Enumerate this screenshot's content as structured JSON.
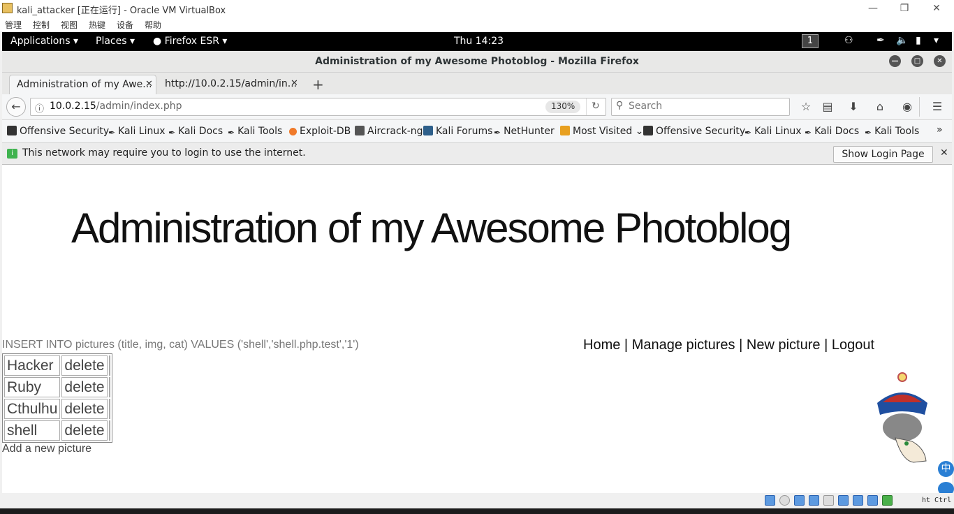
{
  "vbox": {
    "title": "kali_attacker [正在运行] - Oracle VM VirtualBox",
    "menu": [
      "管理",
      "控制",
      "视图",
      "热键",
      "设备",
      "帮助"
    ],
    "status_text": "ht Ctrl"
  },
  "gnome": {
    "applications": "Applications",
    "places": "Places",
    "firefox": "Firefox ESR",
    "clock": "Thu 14:23",
    "workspace": "1"
  },
  "firefox": {
    "window_title": "Administration of my Awesome Photoblog - Mozilla Firefox",
    "tabs": [
      {
        "label": "Administration of my Awe...",
        "active": true
      },
      {
        "label": "http://10.0.2.15/admin/in...",
        "active": false
      }
    ],
    "url_host": "10.0.2.15",
    "url_path": "/admin/index.php",
    "zoom": "130%",
    "search_placeholder": "Search",
    "bookmarks": [
      "Offensive Security",
      "Kali Linux",
      "Kali Docs",
      "Kali Tools",
      "Exploit-DB",
      "Aircrack-ng",
      "Kali Forums",
      "NetHunter",
      "Most Visited",
      "Offensive Security",
      "Kali Linux",
      "Kali Docs",
      "Kali Tools"
    ],
    "notice": "This network may require you to login to use the internet.",
    "notice_button": "Show Login Page"
  },
  "page": {
    "heading": "Administration of my Awesome Photoblog",
    "sql": "INSERT INTO pictures (title, img, cat) VALUES ('shell','shell.php.test','1')",
    "nav": {
      "home": "Home",
      "manage": "Manage pictures",
      "new": "New picture",
      "logout": "Logout",
      "sep": "|"
    },
    "pictures": [
      {
        "title": "Hacker",
        "action": "delete"
      },
      {
        "title": "Ruby",
        "action": "delete"
      },
      {
        "title": "Cthulhu",
        "action": "delete"
      },
      {
        "title": "shell",
        "action": "delete"
      }
    ],
    "add_link": "Add a new picture"
  }
}
